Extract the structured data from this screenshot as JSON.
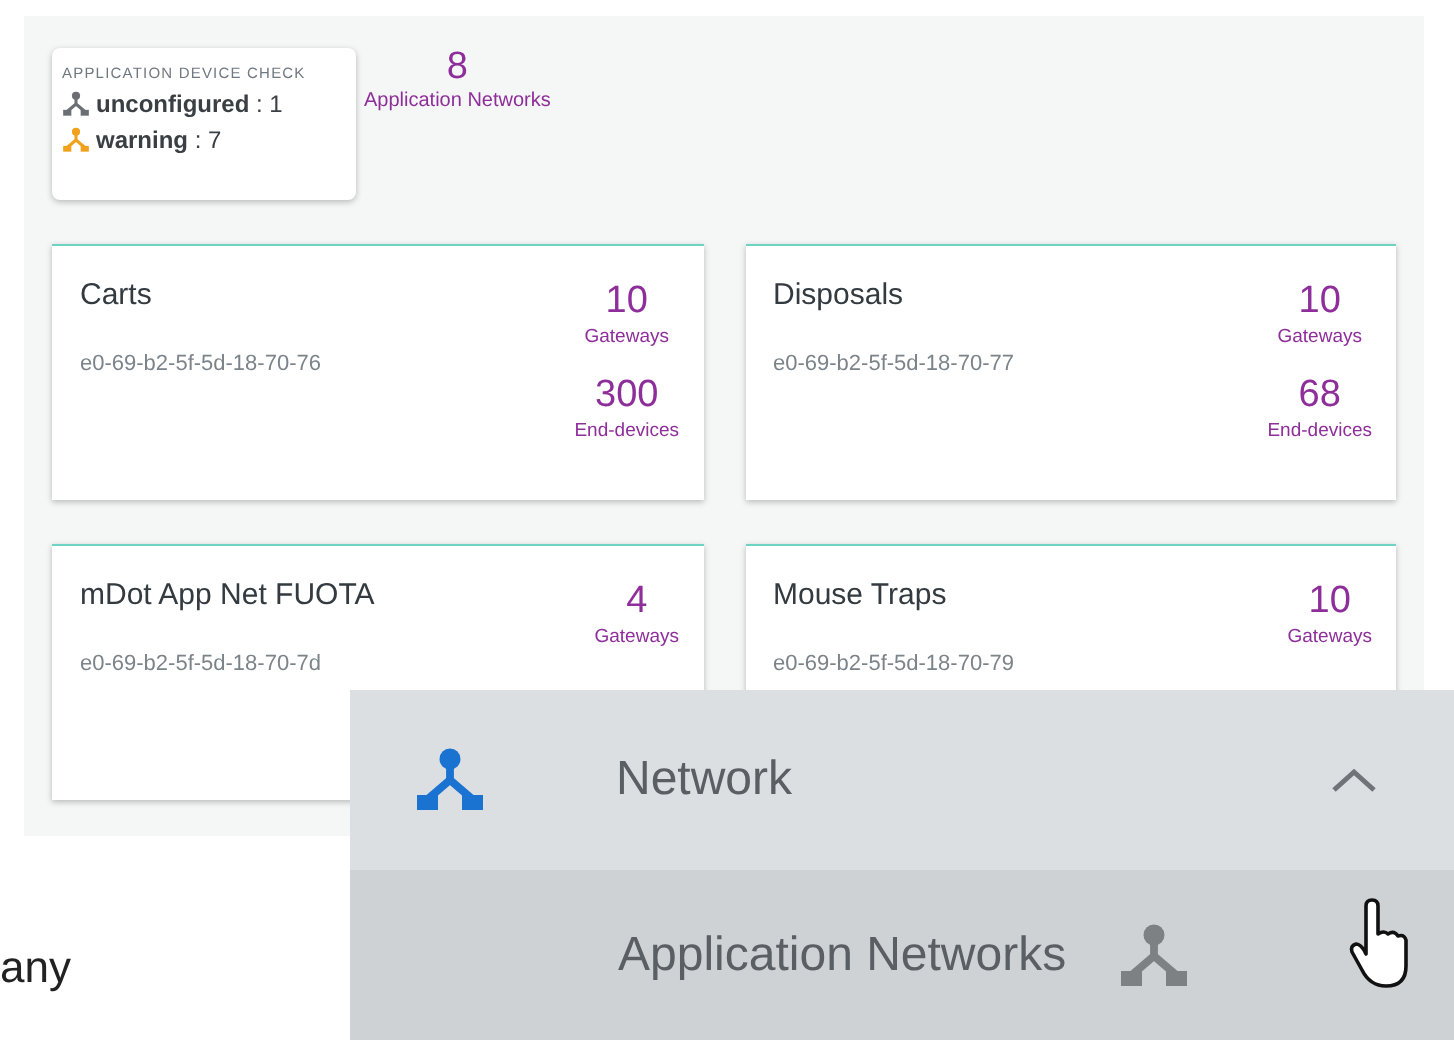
{
  "device_check": {
    "title": "APPLICATION DEVICE CHECK",
    "items": [
      {
        "kind": "unconfigured",
        "label": "unconfigured",
        "count": " : 1"
      },
      {
        "kind": "warning",
        "label": "warning",
        "count": " : 7"
      }
    ]
  },
  "summary": {
    "value": "8",
    "label": "Application Networks"
  },
  "networks": [
    {
      "name": "Carts",
      "id": "e0-69-b2-5f-5d-18-70-76",
      "stats": [
        {
          "value": "10",
          "label": "Gateways"
        },
        {
          "value": "300",
          "label": "End-devices"
        }
      ]
    },
    {
      "name": "Disposals",
      "id": "e0-69-b2-5f-5d-18-70-77",
      "stats": [
        {
          "value": "10",
          "label": "Gateways"
        },
        {
          "value": "68",
          "label": "End-devices"
        }
      ]
    },
    {
      "name": "mDot App Net FUOTA",
      "id": "e0-69-b2-5f-5d-18-70-7d",
      "stats": [
        {
          "value": "4",
          "label": "Gateways"
        }
      ]
    },
    {
      "name": "Mouse Traps",
      "id": "e0-69-b2-5f-5d-18-70-79",
      "stats": [
        {
          "value": "10",
          "label": "Gateways"
        }
      ]
    }
  ],
  "background_text": "any",
  "menu": {
    "section": {
      "label": "Network",
      "expanded": true
    },
    "items": [
      {
        "label": "Application Networks",
        "selected": true
      }
    ]
  }
}
